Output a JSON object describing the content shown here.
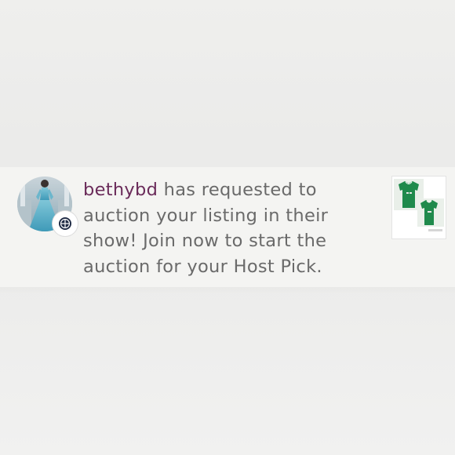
{
  "notification": {
    "username": "bethybd",
    "message_text": " has requested to auction your listing in their show! Join now to start the auction for your Host Pick.",
    "avatar_icon": "user-avatar",
    "badge_icon": "live-show-icon",
    "thumbnail_icon": "listing-thumbnail"
  },
  "colors": {
    "username": "#6a2b5a",
    "text": "#6a6a6a",
    "shirt": "#1f8a4c"
  }
}
